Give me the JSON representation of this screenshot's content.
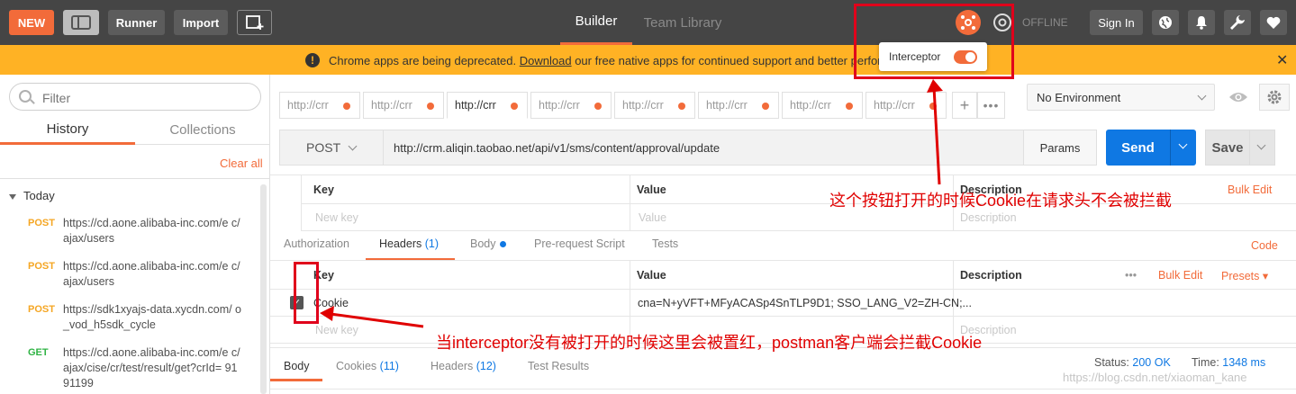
{
  "topbar": {
    "new_label": "NEW",
    "runner_label": "Runner",
    "import_label": "Import",
    "builder_label": "Builder",
    "team_library_label": "Team Library",
    "offline_label": "OFFLINE",
    "signin_label": "Sign In"
  },
  "banner": {
    "text_before": "Chrome apps are being deprecated. ",
    "link": "Download",
    "text_after": " our free native apps for continued support and better perform"
  },
  "interceptor": {
    "label": "Interceptor",
    "enabled": true
  },
  "sidebar": {
    "filter_placeholder": "Filter",
    "tab_history": "History",
    "tab_collections": "Collections",
    "clear_all": "Clear all",
    "group_today": "Today",
    "history": [
      {
        "method": "POST",
        "method_color": "#f5a623",
        "url": "https://cd.aone.alibaba-inc.com/e c/ajax/users"
      },
      {
        "method": "POST",
        "method_color": "#f5a623",
        "url": "https://cd.aone.alibaba-inc.com/e c/ajax/users"
      },
      {
        "method": "POST",
        "method_color": "#f5a623",
        "url": "https://sdk1xyajs-data.xycdn.com/ o_vod_h5sdk_cycle"
      },
      {
        "method": "GET",
        "method_color": "#2fb344",
        "url": "https://cd.aone.alibaba-inc.com/e c/ajax/cise/cr/test/result/get?crId= 9191199"
      }
    ]
  },
  "tabs": [
    "http://crr",
    "http://crr",
    "http://crr",
    "http://crr",
    "http://crr",
    "http://crr",
    "http://crr",
    "http://crr"
  ],
  "environment": {
    "selected": "No Environment"
  },
  "request": {
    "method": "POST",
    "url": "http://crm.aliqin.taobao.net/api/v1/sms/content/approval/update",
    "params_label": "Params",
    "send_label": "Send",
    "save_label": "Save"
  },
  "params_table": {
    "col_key": "Key",
    "col_value": "Value",
    "col_description": "Description",
    "bulk_edit": "Bulk Edit",
    "key_placeholder": "New key",
    "value_placeholder": "Value",
    "description_placeholder": "Description"
  },
  "request_tabs": {
    "authorization": "Authorization",
    "headers": "Headers",
    "headers_count": "(1)",
    "body": "Body",
    "prerequest": "Pre-request Script",
    "tests": "Tests",
    "code": "Code"
  },
  "headers_table": {
    "col_key": "Key",
    "col_value": "Value",
    "col_description": "Description",
    "more": "•••",
    "bulk_edit": "Bulk Edit",
    "presets": "Presets ▾",
    "row_key": "Cookie",
    "row_value": "cna=N+yVFT+MFyACASp4SnTLP9D1; SSO_LANG_V2=ZH-CN;...",
    "key_placeholder": "New key",
    "description_placeholder": "Description"
  },
  "response_tabs": {
    "body": "Body",
    "cookies": "Cookies",
    "cookies_count": "(11)",
    "headers": "Headers",
    "headers_count": "(12)",
    "test_results": "Test Results",
    "status_label": "Status:",
    "status_value": "200 OK",
    "time_label": "Time:",
    "time_value": "1348 ms"
  },
  "annotations": {
    "note_top": "这个按钮打开的时候Cookie在请求头不会被拦截",
    "note_bottom": "当interceptor没有被打开的时候这里会被置红，postman客户端会拦截Cookie"
  },
  "watermark": "https://blog.csdn.net/xiaoman_kane"
}
